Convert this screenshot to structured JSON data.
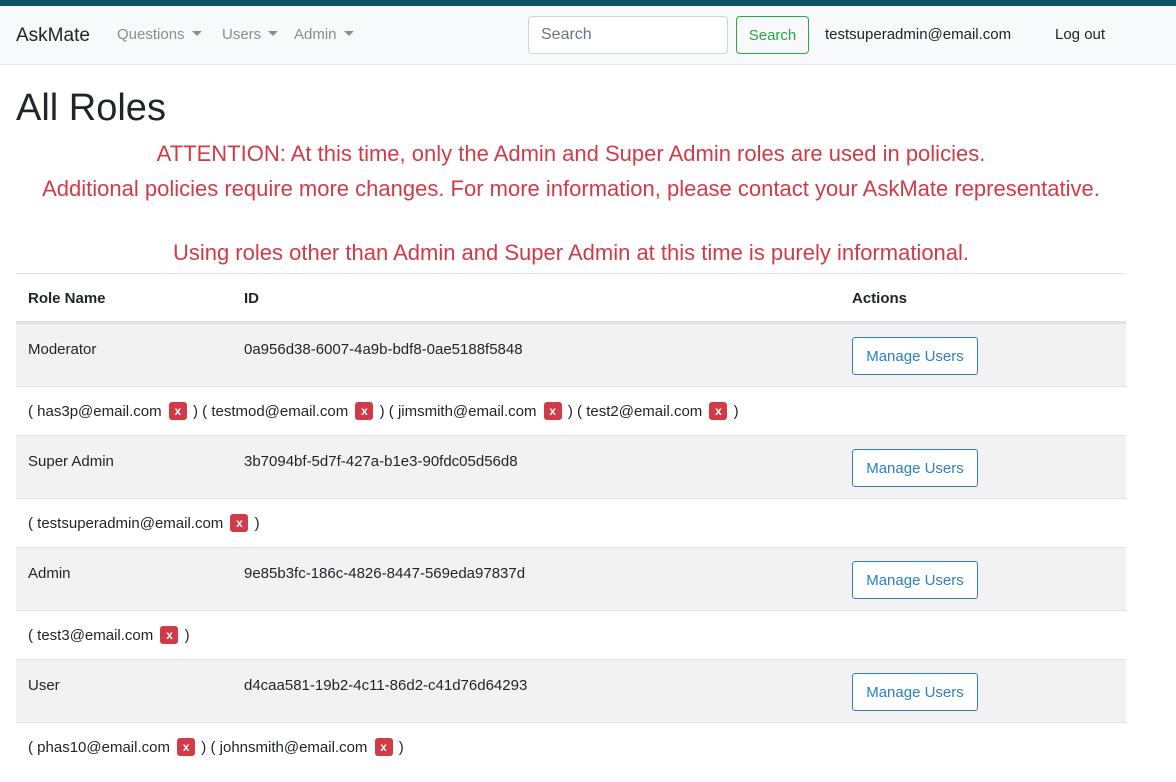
{
  "nav": {
    "brand": "AskMate",
    "menus": [
      {
        "label": "Questions"
      },
      {
        "label": "Users"
      },
      {
        "label": "Admin"
      }
    ],
    "search_placeholder": "Search",
    "search_button": "Search",
    "user_email": "testsuperadmin@email.com",
    "logout": "Log out"
  },
  "page": {
    "title": "All Roles",
    "attention": [
      "ATTENTION: At this time, only the Admin and Super Admin roles are used in policies.",
      "Additional policies require more changes. For more information, please contact your AskMate representative.",
      "Using roles other than Admin and Super Admin at this time is purely informational."
    ]
  },
  "table": {
    "headers": {
      "role_name": "Role Name",
      "id": "ID",
      "actions": "Actions"
    },
    "manage_label": "Manage Users",
    "remove_label": "x",
    "roles": [
      {
        "name": "Moderator",
        "id": "0a956d38-6007-4a9b-bdf8-0ae5188f5848",
        "users": [
          "has3p@email.com",
          "testmod@email.com",
          "jimsmith@email.com",
          "test2@email.com"
        ]
      },
      {
        "name": "Super Admin",
        "id": "3b7094bf-5d7f-427a-b1e3-90fdc05d56d8",
        "users": [
          "testsuperadmin@email.com"
        ]
      },
      {
        "name": "Admin",
        "id": "9e85b3fc-186c-4826-8447-569eda97837d",
        "users": [
          "test3@email.com"
        ]
      },
      {
        "name": "User",
        "id": "d4caa581-19b2-4c11-86d2-c41d76d64293",
        "users": [
          "phas10@email.com",
          "johnsmith@email.com"
        ]
      }
    ]
  }
}
